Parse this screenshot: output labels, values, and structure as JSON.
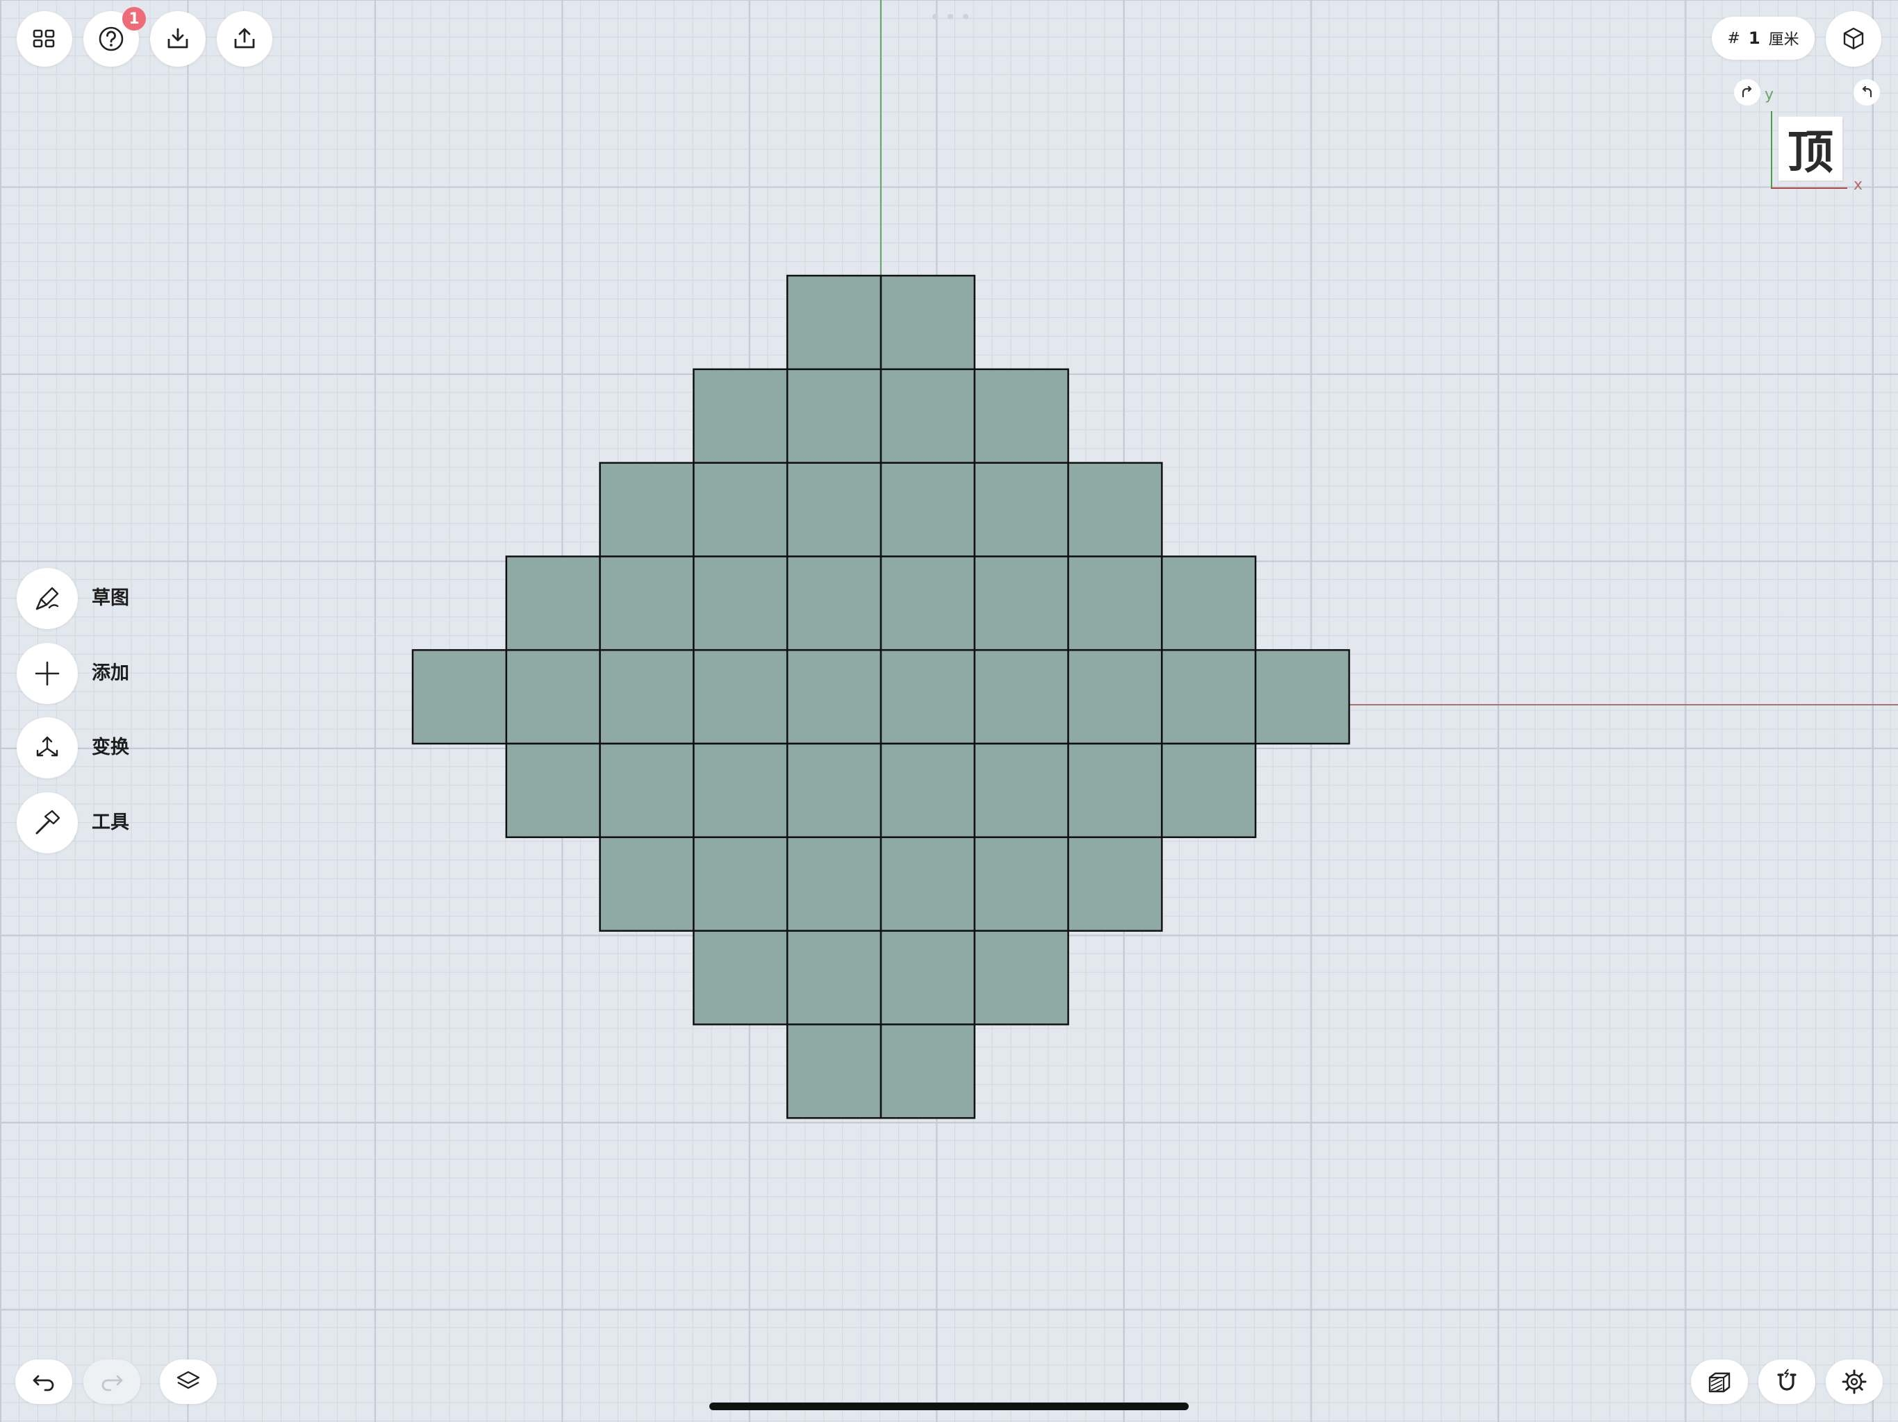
{
  "top_toolbar": {
    "icons": [
      "grid-menu-icon",
      "help-icon",
      "import-icon",
      "share-icon"
    ],
    "help_badge": "1"
  },
  "unit_pill": {
    "hash": "#",
    "value": "1",
    "unit": "厘米"
  },
  "view_cube": {
    "face_label": "顶",
    "axis_y": "y",
    "axis_x": "x",
    "axis_y_color": "#4b9c4b",
    "axis_x_color": "#b34b4b"
  },
  "side_menu": {
    "items": [
      {
        "label": "草图",
        "icon": "pen-sketch-icon"
      },
      {
        "label": "添加",
        "icon": "plus-icon"
      },
      {
        "label": "变换",
        "icon": "transform-arrows-icon"
      },
      {
        "label": "工具",
        "icon": "hammer-icon"
      }
    ]
  },
  "canvas": {
    "shape_fill": "#8fa9a4",
    "shape_stroke": "#111111",
    "row_widths": [
      2,
      4,
      6,
      8,
      10,
      8,
      6,
      4,
      2
    ]
  },
  "bottom_toolbar": {
    "left": [
      "undo-icon",
      "redo-icon",
      "layers-icon"
    ],
    "right": [
      "section-view-icon",
      "snap-magnet-icon",
      "settings-gear-icon"
    ]
  }
}
